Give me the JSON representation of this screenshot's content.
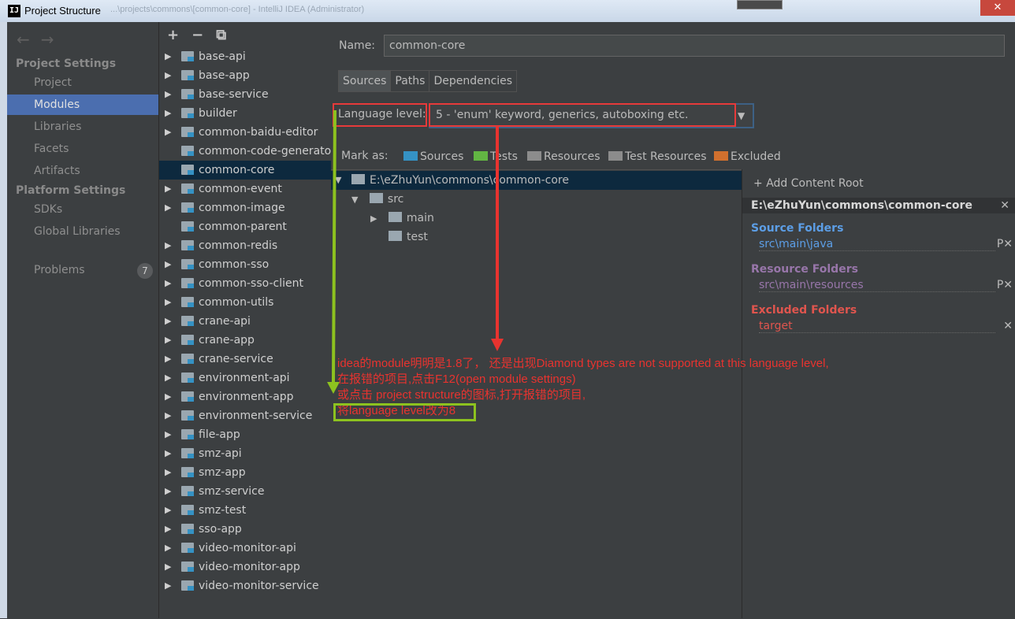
{
  "window": {
    "title": "Project Structure",
    "background_title": "...\\projects\\commons\\[common-core] - IntelliJ IDEA (Administrator)",
    "close_label": "✕"
  },
  "nav": {
    "back_icon": "left-arrow-icon",
    "forward_icon": "right-arrow-icon",
    "project_settings_header": "Project Settings",
    "project_settings": [
      "Project",
      "Modules",
      "Libraries",
      "Facets",
      "Artifacts"
    ],
    "platform_settings_header": "Platform Settings",
    "platform_settings": [
      "SDKs",
      "Global Libraries"
    ],
    "problems_label": "Problems",
    "problems_count": "7",
    "selected": "Modules"
  },
  "modules_toolbar": {
    "add": "+",
    "remove": "−",
    "copy": "⧉"
  },
  "modules": [
    "base-api",
    "base-app",
    "base-service",
    "builder",
    "common-baidu-editor",
    "common-code-generato",
    "common-core",
    "common-event",
    "common-image",
    "common-parent",
    "common-redis",
    "common-sso",
    "common-sso-client",
    "common-utils",
    "crane-api",
    "crane-app",
    "crane-service",
    "environment-api",
    "environment-app",
    "environment-service",
    "file-app",
    "smz-api",
    "smz-app",
    "smz-service",
    "smz-test",
    "sso-app",
    "video-monitor-api",
    "video-monitor-app",
    "video-monitor-service"
  ],
  "selected_module": "common-core",
  "detail": {
    "name_label": "Name:",
    "name_value": "common-core",
    "tabs": [
      "Sources",
      "Paths",
      "Dependencies"
    ],
    "selected_tab": "Sources",
    "language_level_label": "Language level:",
    "language_level_value": "5 - 'enum' keyword, generics, autoboxing etc.",
    "mark_as_label": "Mark as:",
    "mark_as": [
      {
        "label": "Sources",
        "color": "#3592c4"
      },
      {
        "label": "Tests",
        "color": "#62b543"
      },
      {
        "label": "Resources",
        "color": "#8c8c8c"
      },
      {
        "label": "Test Resources",
        "color": "#8c8c8c"
      },
      {
        "label": "Excluded",
        "color": "#d1702e"
      }
    ],
    "tree": {
      "root": "E:\\eZhuYun\\commons\\common-core",
      "src": "src",
      "main": "main",
      "test": "test"
    },
    "content_root": {
      "add_label": "Add Content Root",
      "path": "E:\\eZhuYun\\commons\\common-core",
      "source_header": "Source Folders",
      "source_path": "src\\main\\java",
      "resource_header": "Resource Folders",
      "resource_path": "src\\main\\resources",
      "excluded_header": "Excluded Folders",
      "excluded_path": "target",
      "colors": {
        "source": "#5c9ee6",
        "resource": "#9876aa",
        "excluded": "#e0554e"
      }
    }
  },
  "annotation": {
    "lines": [
      "idea的module明明是1.8了， 还是出现Diamond types are not supported at this language level,",
      "在报错的项目,点击F12(open module settings)",
      "或点击 project structure的图标,打开报错的项目,",
      "将language level改为8"
    ],
    "red": "#e8332f",
    "green": "#8dc21f"
  }
}
